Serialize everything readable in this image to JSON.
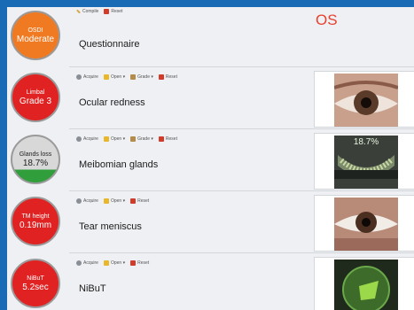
{
  "header": {
    "eye_label": "OS"
  },
  "rows": [
    {
      "gauge": {
        "sub": "OSDI",
        "main": "Moderate"
      },
      "toolbar": [
        {
          "icon": "compile-icon",
          "label": "Compile"
        },
        {
          "icon": "reset-icon",
          "label": "Reset"
        }
      ],
      "label": "Questionnaire"
    },
    {
      "gauge": {
        "sub": "Limbal",
        "main": "Grade 3"
      },
      "toolbar": [
        {
          "icon": "acquire-icon",
          "label": "Acquire"
        },
        {
          "icon": "open-icon",
          "label": "Open ▾"
        },
        {
          "icon": "grade-icon",
          "label": "Grade ▾"
        },
        {
          "icon": "reset-icon",
          "label": "Reset"
        }
      ],
      "label": "Ocular redness"
    },
    {
      "gauge": {
        "sub": "Glands loss",
        "main": "18.7%"
      },
      "toolbar": [
        {
          "icon": "acquire-icon",
          "label": "Acquire"
        },
        {
          "icon": "open-icon",
          "label": "Open ▾"
        },
        {
          "icon": "grade-icon",
          "label": "Grade ▾"
        },
        {
          "icon": "reset-icon",
          "label": "Reset"
        }
      ],
      "label": "Meibomian glands",
      "thumb_text": "18.7%"
    },
    {
      "gauge": {
        "sub": "TM height",
        "main": "0.19mm"
      },
      "toolbar": [
        {
          "icon": "acquire-icon",
          "label": "Acquire"
        },
        {
          "icon": "open-icon",
          "label": "Open ▾"
        },
        {
          "icon": "reset-icon",
          "label": "Reset"
        }
      ],
      "label": "Tear meniscus"
    },
    {
      "gauge": {
        "sub": "NiBuT",
        "main": "5.2sec"
      },
      "toolbar": [
        {
          "icon": "acquire-icon",
          "label": "Acquire"
        },
        {
          "icon": "open-icon",
          "label": "Open ▾"
        },
        {
          "icon": "reset-icon",
          "label": "Reset"
        }
      ],
      "label": "NiBuT"
    }
  ],
  "colors": {
    "orange": "#f07a22",
    "red": "#e02222",
    "green": "#2f9e3b",
    "accent_text": "#e8402e",
    "frame_blue": "#1a6bb5"
  }
}
